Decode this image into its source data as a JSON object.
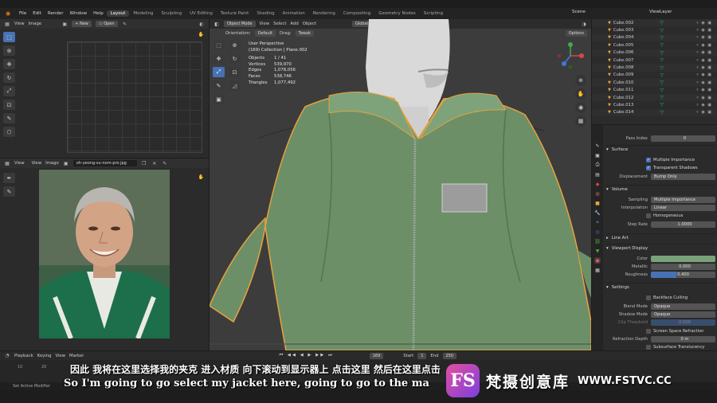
{
  "top_menu": {
    "menus": [
      "File",
      "Edit",
      "Render",
      "Window",
      "Help"
    ],
    "workspaces": [
      "Layout",
      "Modeling",
      "Sculpting",
      "UV Editing",
      "Texture Paint",
      "Shading",
      "Animation",
      "Rendering",
      "Compositing",
      "Geometry Nodes",
      "Scripting"
    ],
    "active_workspace": "Layout",
    "scene": "Scene",
    "view_layer": "ViewLayer"
  },
  "uv_editor": {
    "header": [
      "View",
      "Image"
    ],
    "new_label": "New",
    "open_label": "Open"
  },
  "image_editor": {
    "header": [
      "View",
      "View",
      "Image"
    ],
    "filename": "oh-yeong-su-nom-pro.jpg"
  },
  "viewport": {
    "mode": "Object Mode",
    "menus": [
      "View",
      "Select",
      "Add",
      "Object"
    ],
    "orientation_label": "Orientation:",
    "orientation": "Default",
    "drag_label": "Drag:",
    "drag": "Tweak",
    "transform": "Global",
    "options": "Options",
    "stats": {
      "line1": "User Perspective",
      "line2": "(169) Collection | Plane.002",
      "objects_label": "Objects",
      "objects": "1 / 41",
      "vertices_label": "Vertices",
      "vertices": "539,970",
      "edges_label": "Edges",
      "edges": "1,078,056",
      "faces_label": "Faces",
      "faces": "538,746",
      "triangles_label": "Triangles",
      "triangles": "1,077,492"
    }
  },
  "outliner": {
    "items": [
      "Cube.002",
      "Cube.003",
      "Cube.004",
      "Cube.005",
      "Cube.006",
      "Cube.007",
      "Cube.008",
      "Cube.009",
      "Cube.010",
      "Cube.011",
      "Cube.012",
      "Cube.013",
      "Cube.014"
    ]
  },
  "properties": {
    "pass_index_label": "Pass Index",
    "pass_index": "0",
    "surface": {
      "title": "Surface",
      "multiple_importance": "Multiple Importance",
      "transparent_shadows": "Transparent Shadows",
      "displacement_label": "Displacement",
      "displacement": "Bump Only"
    },
    "volume": {
      "title": "Volume",
      "sampling_label": "Sampling",
      "sampling": "Multiple Importance",
      "interpolation_label": "Interpolation",
      "interpolation": "Linear",
      "homogeneous": "Homogeneous",
      "step_rate_label": "Step Rate",
      "step_rate": "1.0000"
    },
    "line_art_title": "Line Art",
    "viewport_display": {
      "title": "Viewport Display",
      "color_label": "Color",
      "color_value": "#7aa27a",
      "metallic_label": "Metallic",
      "metallic": "0.000",
      "roughness_label": "Roughness",
      "roughness": "0.400",
      "roughness_fraction": 0.4
    },
    "settings": {
      "title": "Settings",
      "backface_culling": "Backface Culling",
      "blend_mode_label": "Blend Mode",
      "blend_mode": "Opaque",
      "shadow_mode_label": "Shadow Mode",
      "shadow_mode": "Opaque",
      "clip_threshold_label": "Clip Threshold",
      "clip_threshold": "0.500",
      "screen_space_refraction": "Screen Space Refraction",
      "refraction_depth_label": "Refraction Depth",
      "refraction_depth": "0 m",
      "subsurface_translucency": "Subsurface Translucency",
      "last_value": "0"
    }
  },
  "timeline": {
    "menus": [
      "Playback",
      "Keying",
      "View",
      "Marker"
    ],
    "current_frame": "169",
    "start_label": "Start",
    "start": "1",
    "end_label": "End",
    "end": "250",
    "ticks": [
      "10",
      "20"
    ]
  },
  "status_bar": {
    "hint": "Set Active Modifier"
  },
  "subtitles": {
    "chinese": "因此 我将在这里选择我的夹克 进入材质 向下滚动到显示器上 点击这里 然后在这里点击",
    "english": "So I'm going to go select my jacket here, going to go to the ma"
  },
  "watermark": {
    "badge": "FS",
    "name": "梵摄创意库",
    "url": "WWW.FSTVC.CC"
  },
  "colors": {
    "accent_blue": "#4772b3",
    "jacket_green": "#6c8f68",
    "selection_orange": "#e8a23d"
  }
}
